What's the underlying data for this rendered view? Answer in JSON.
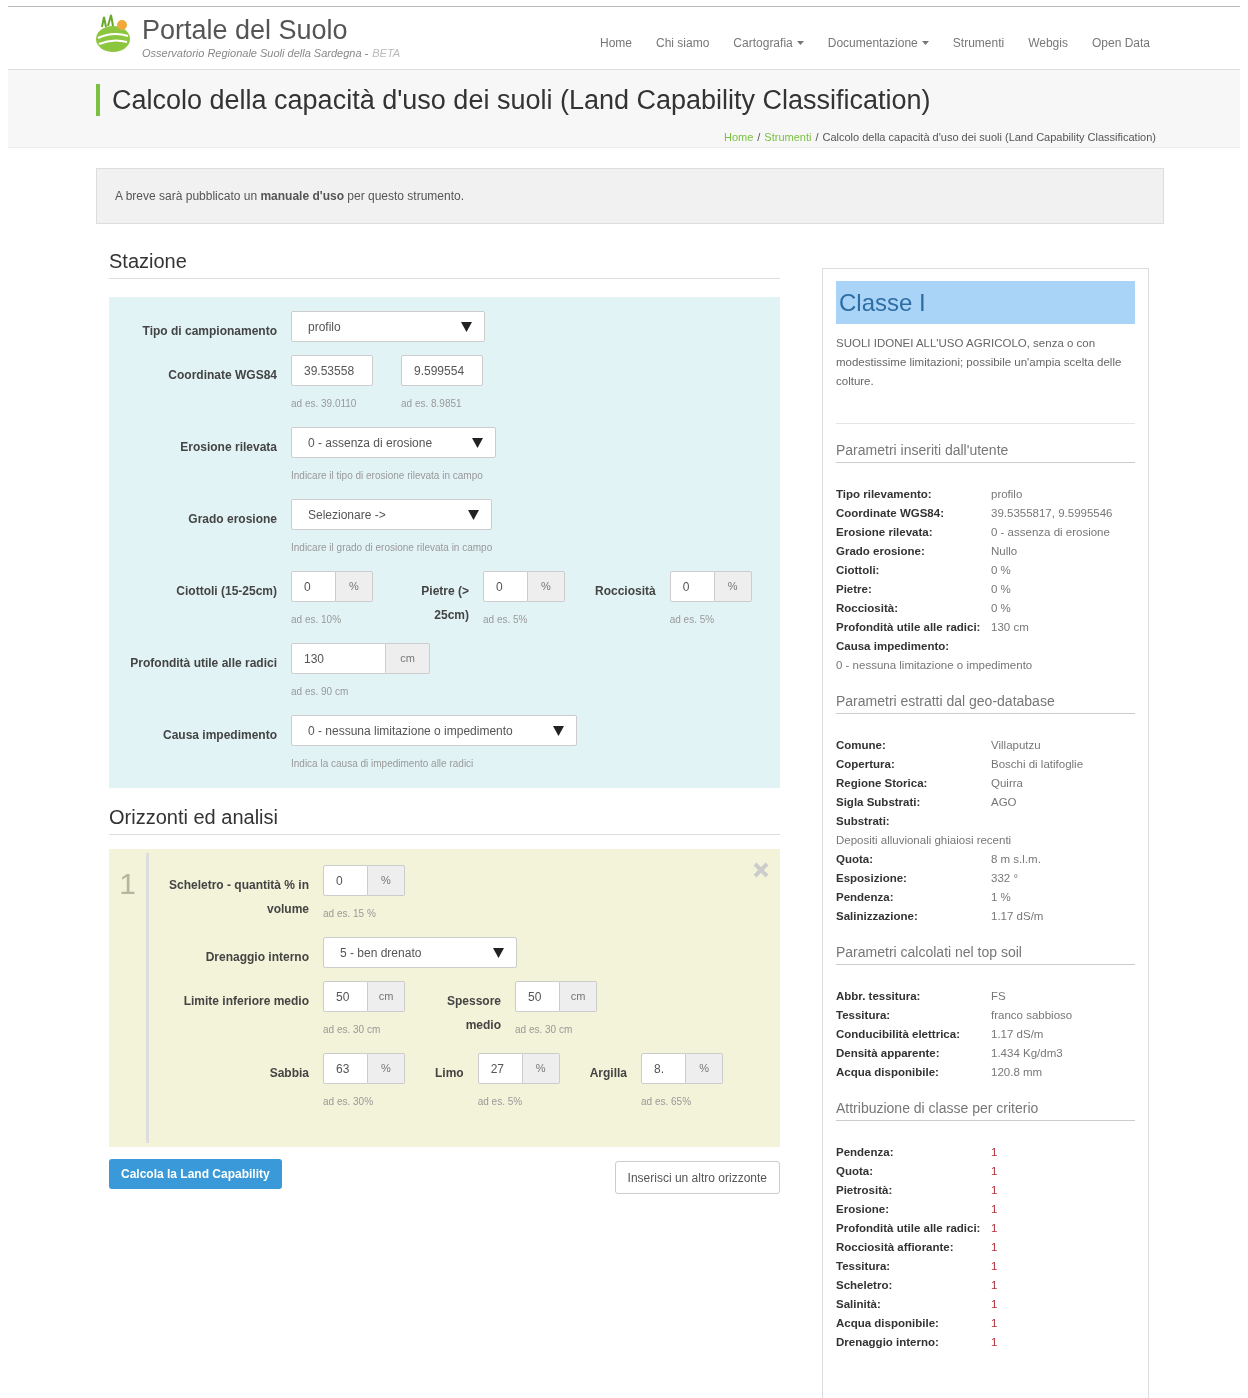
{
  "header": {
    "title": "Portale del Suolo",
    "subtitle": "Osservatorio Regionale Suoli della Sardegna -",
    "badge": "BETA",
    "nav": [
      {
        "label": "Home",
        "dropdown": false
      },
      {
        "label": "Chi siamo",
        "dropdown": false
      },
      {
        "label": "Cartografia",
        "dropdown": true
      },
      {
        "label": "Documentazione",
        "dropdown": true
      },
      {
        "label": "Strumenti",
        "dropdown": false
      },
      {
        "label": "Webgis",
        "dropdown": false
      },
      {
        "label": "Open Data",
        "dropdown": false
      }
    ]
  },
  "page_title": "Calcolo della capacità d'uso dei suoli (Land Capability Classification)",
  "breadcrumb": [
    {
      "label": "Home",
      "link": true
    },
    {
      "separator": "/",
      "label": "Strumenti",
      "link": true
    },
    {
      "separator": "/",
      "label": "Calcolo della capacità d'uso dei suoli (Land Capability Classification)",
      "link": false
    }
  ],
  "notice": "A breve sarà pubblicato un **manuale d'uso** per questo strumento.",
  "station": {
    "heading": "Stazione",
    "rows": [
      {
        "groups": [
          {
            "label": "Tipo di campionamento",
            "fields": [
              {
                "kind": "select",
                "value": "profilo"
              }
            ]
          }
        ]
      },
      {
        "groups": [
          {
            "label": "Coordinate WGS84",
            "fields": [
              {
                "kind": "text",
                "value": "39.53558",
                "hint": "ad es. 39.0110"
              },
              {
                "kind": "text",
                "value": "9.599554",
                "hint": "ad es. 8.9851"
              }
            ]
          }
        ]
      },
      {
        "groups": [
          {
            "label": "Erosione rilevata",
            "fields": [
              {
                "kind": "select",
                "value": "0 - assenza di erosione",
                "hint": "Indicare il tipo di erosione rilevata in campo"
              }
            ]
          }
        ]
      },
      {
        "groups": [
          {
            "label": "Grado erosione",
            "fields": [
              {
                "kind": "select",
                "value": "Selezionare ->",
                "hint": "Indicare il grado di erosione rilevata in campo"
              }
            ]
          }
        ]
      },
      {
        "groups": [
          {
            "label": "Ciottoli (15-25cm)",
            "fields": [
              {
                "kind": "addon",
                "value": "0",
                "unit": "%",
                "hint": "ad es. 10%"
              }
            ]
          },
          {
            "label": "Pietre (> 25cm)",
            "fields": [
              {
                "kind": "addon",
                "value": "0",
                "unit": "%",
                "hint": "ad es. 5%"
              }
            ]
          },
          {
            "label": "Rocciosità",
            "fields": [
              {
                "kind": "addon",
                "value": "0",
                "unit": "%",
                "hint": "ad es. 5%"
              }
            ]
          }
        ]
      },
      {
        "groups": [
          {
            "label": "Profondità utile alle radici",
            "fields": [
              {
                "kind": "addon",
                "value": "130",
                "unit": "cm",
                "hint": "ad es. 90 cm"
              }
            ]
          }
        ]
      },
      {
        "groups": [
          {
            "label": "Causa impedimento",
            "fields": [
              {
                "kind": "select",
                "value": "0 - nessuna limitazione o impedimento",
                "hint": "Indica la causa di impedimento alle radici"
              }
            ]
          }
        ]
      }
    ]
  },
  "horizons": {
    "heading": "Orizzonti ed analisi",
    "items": [
      {
        "number": "1",
        "rows": [
          {
            "groups": [
              {
                "label": "Scheletro - quantità % in volume",
                "fields": [
                  {
                    "kind": "addon",
                    "value": "0",
                    "unit": "%",
                    "hint": "ad es. 15 %"
                  }
                ]
              }
            ]
          },
          {
            "groups": [
              {
                "label": "Drenaggio interno",
                "fields": [
                  {
                    "kind": "select",
                    "value": "5 - ben drenato"
                  }
                ]
              }
            ]
          },
          {
            "groups": [
              {
                "label": "Limite inferiore medio",
                "fields": [
                  {
                    "kind": "addon",
                    "value": "50",
                    "unit": "cm",
                    "hint": "ad es. 30 cm"
                  }
                ]
              },
              {
                "label": "Spessore medio",
                "fields": [
                  {
                    "kind": "addon",
                    "value": "50",
                    "unit": "cm",
                    "hint": "ad es. 30 cm"
                  }
                ]
              }
            ]
          },
          {
            "groups": [
              {
                "label": "Sabbia",
                "fields": [
                  {
                    "kind": "addon",
                    "value": "63",
                    "unit": "%",
                    "hint": "ad es. 30%"
                  }
                ]
              },
              {
                "label": "Limo",
                "fields": [
                  {
                    "kind": "addon",
                    "value": "27",
                    "unit": "%",
                    "hint": "ad es. 5%"
                  }
                ]
              },
              {
                "label": "Argilla",
                "fields": [
                  {
                    "kind": "addon",
                    "value": "8.",
                    "unit": "%",
                    "hint": "ad es. 65%"
                  }
                ]
              }
            ]
          }
        ]
      }
    ]
  },
  "buttons": [
    {
      "label": "Calcola la Land Capability",
      "kind": "primary"
    },
    {
      "label": "Inserisci un altro orizzonte",
      "kind": "default"
    }
  ],
  "result": {
    "class": "Classe I",
    "description": "SUOLI IDONEI ALL'USO AGRICOLO, senza o con modestissime limitazioni; possibile un'ampia scelta delle colture.",
    "sections": [
      {
        "title": "Parametri inseriti dall'utente",
        "kind": "params",
        "rows": [
          {
            "label": "Tipo rilevamento:",
            "value": "profilo",
            "kind": "inline"
          },
          {
            "label": "Coordinate WGS84:",
            "value": "39.5355817, 9.5995546",
            "kind": "inline"
          },
          {
            "label": "Erosione rilevata:",
            "value": "0 - assenza di erosione",
            "kind": "inline"
          },
          {
            "label": "Grado erosione:",
            "value": "Nullo",
            "kind": "inline"
          },
          {
            "label": "Ciottoli:",
            "value": "0 %",
            "kind": "inline"
          },
          {
            "label": "Pietre:",
            "value": "0 %",
            "kind": "inline"
          },
          {
            "label": "Rocciosità:",
            "value": "0 %",
            "kind": "inline"
          },
          {
            "label": "Profondità utile alle radici:",
            "value": "130 cm",
            "kind": "inline"
          },
          {
            "label": "Causa impedimento:",
            "value": "0 - nessuna limitazione o impedimento",
            "kind": "stacked"
          }
        ]
      },
      {
        "title": "Parametri estratti dal geo-database",
        "kind": "params",
        "rows": [
          {
            "label": "Comune:",
            "value": "Villaputzu",
            "kind": "inline"
          },
          {
            "label": "Copertura:",
            "value": "Boschi di latifoglie",
            "kind": "inline"
          },
          {
            "label": "Regione Storica:",
            "value": "Quirra",
            "kind": "inline"
          },
          {
            "label": "Sigla Substrati:",
            "value": "AGO",
            "kind": "inline"
          },
          {
            "label": "Substrati:",
            "value": "Depositi alluvionali ghiaiosi recenti",
            "kind": "stacked"
          },
          {
            "label": "Quota:",
            "value": "8 m s.l.m.",
            "kind": "inline"
          },
          {
            "label": "Esposizione:",
            "value": "332 °",
            "kind": "inline"
          },
          {
            "label": "Pendenza:",
            "value": "1 %",
            "kind": "inline"
          },
          {
            "label": "Salinizzazione:",
            "value": "1.17 dS/m",
            "kind": "inline"
          }
        ]
      },
      {
        "title": "Parametri calcolati nel top soil",
        "kind": "params",
        "rows": [
          {
            "label": "Abbr. tessitura:",
            "value": "FS",
            "kind": "inline"
          },
          {
            "label": "Tessitura:",
            "value": "franco sabbioso",
            "kind": "inline"
          },
          {
            "label": "Conducibilità elettrica:",
            "value": "1.17 dS/m",
            "kind": "inline"
          },
          {
            "label": "Densità apparente:",
            "value": "1.434 Kg/dm3",
            "kind": "inline"
          },
          {
            "label": "Acqua disponibile:",
            "value": "120.8 mm",
            "kind": "inline"
          }
        ]
      },
      {
        "title": "Attribuzione di classe per criterio",
        "kind": "classes",
        "rows": [
          {
            "label": "Pendenza:",
            "value": "1",
            "kind": "inline"
          },
          {
            "label": "Quota:",
            "value": "1",
            "kind": "inline"
          },
          {
            "label": "Pietrosità:",
            "value": "1",
            "kind": "inline"
          },
          {
            "label": "Erosione:",
            "value": "1",
            "kind": "inline"
          },
          {
            "label": "Profondità utile alle radici:",
            "value": "1",
            "kind": "inline"
          },
          {
            "label": "Rocciosità affiorante:",
            "value": "1",
            "kind": "inline"
          },
          {
            "label": "Tessitura:",
            "value": "1",
            "kind": "inline"
          },
          {
            "label": "Scheletro:",
            "value": "1",
            "kind": "inline"
          },
          {
            "label": "Salinità:",
            "value": "1",
            "kind": "inline"
          },
          {
            "label": "Acqua disponibile:",
            "value": "1",
            "kind": "inline"
          },
          {
            "label": "Drenaggio interno:",
            "value": "1",
            "kind": "inline"
          }
        ]
      }
    ]
  }
}
